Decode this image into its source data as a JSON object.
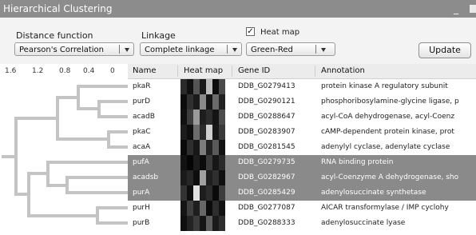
{
  "window": {
    "title": "Hierarchical Clustering",
    "minimize": "_"
  },
  "controls": {
    "distance": {
      "label": "Distance function",
      "value": "Pearson's Correlation"
    },
    "linkage": {
      "label": "Linkage",
      "value": "Complete linkage"
    },
    "heatmap": {
      "label": "Heat map",
      "checked": "✓",
      "value": "Green-Red"
    },
    "update_label": "Update"
  },
  "dendrogram": {
    "ticks": [
      "1.6",
      "1.2",
      "0.8",
      "0.4",
      "0"
    ]
  },
  "table": {
    "columns": [
      "Name",
      "Heat map",
      "Gene ID",
      "Annotation"
    ],
    "rows": [
      {
        "name": "pkaR",
        "gene": "DDB_G0279413",
        "annotation": "protein kinase A regulatory subunit",
        "selected": false
      },
      {
        "name": "purD",
        "gene": "DDB_G0290121",
        "annotation": "phosphoribosylamine-glycine ligase, p",
        "selected": false
      },
      {
        "name": "acadB",
        "gene": "DDB_G0288647",
        "annotation": "acyl-CoA dehydrogenase, acyl-Coenz",
        "selected": false
      },
      {
        "name": "pkaC",
        "gene": "DDB_G0283907",
        "annotation": "cAMP-dependent protein kinase, prot",
        "selected": false
      },
      {
        "name": "acaA",
        "gene": "DDB_G0281545",
        "annotation": "adenylyl cyclase, adenylate cyclase",
        "selected": false
      },
      {
        "name": "pufA",
        "gene": "DDB_G0279735",
        "annotation": "RNA binding protein",
        "selected": true
      },
      {
        "name": "acadsb",
        "gene": "DDB_G0282967",
        "annotation": "acyl-Coenzyme A dehydrogenase, sho",
        "selected": true
      },
      {
        "name": "purA",
        "gene": "DDB_G0285429",
        "annotation": "adenylosuccinate synthetase",
        "selected": true
      },
      {
        "name": "purH",
        "gene": "DDB_G0277087",
        "annotation": "AICAR transformylase / IMP cyclohy",
        "selected": false
      },
      {
        "name": "purB",
        "gene": "DDB_G0288333",
        "annotation": "adenylosuccinate lyase",
        "selected": false
      }
    ],
    "heatmap_shades": [
      [
        "#2a2a2a",
        "#111111",
        "#555555",
        "#1a1a1a",
        "#bcbcbc",
        "#0d0d0d",
        "#4a4a4a"
      ],
      [
        "#0c0c0c",
        "#303030",
        "#1b1b1b",
        "#8a8a8a",
        "#161616",
        "#6a6a6a",
        "#222222"
      ],
      [
        "#111111",
        "#3d3d3d",
        "#9a9a9a",
        "#1e1e1e",
        "#2c2c2c",
        "#141414",
        "#4c4c4c"
      ],
      [
        "#1c1c1c",
        "#0e0e0e",
        "#6c6c6c",
        "#2a2a2a",
        "#cfcfcf",
        "#181818",
        "#3a3a3a"
      ],
      [
        "#0a0a0a",
        "#2e2e2e",
        "#171717",
        "#7d7d7d",
        "#232323",
        "#5a5a5a",
        "#121212"
      ],
      [
        "#121212",
        "#050505",
        "#1c1c1c",
        "#0b0b0b",
        "#3a3a3a",
        "#161616",
        "#2a2a2a"
      ],
      [
        "#1a1a1a",
        "#262626",
        "#0d0d0d",
        "#a0a0a0",
        "#1f1f1f",
        "#2f2f2f",
        "#101010"
      ],
      [
        "#333333",
        "#0f0f0f",
        "#e0e0e0",
        "#1d1d1d",
        "#2b2b2b",
        "#0a0a0a",
        "#3c3c3c"
      ],
      [
        "#141414",
        "#3f3f3f",
        "#1e1e1e",
        "#676767",
        "#0c0c0c",
        "#2d2d2d",
        "#121212"
      ],
      [
        "#0f0f0f",
        "#232323",
        "#3b3b3b",
        "#141414",
        "#5e5e5e",
        "#1a1a1a",
        "#2e2e2e"
      ]
    ]
  }
}
